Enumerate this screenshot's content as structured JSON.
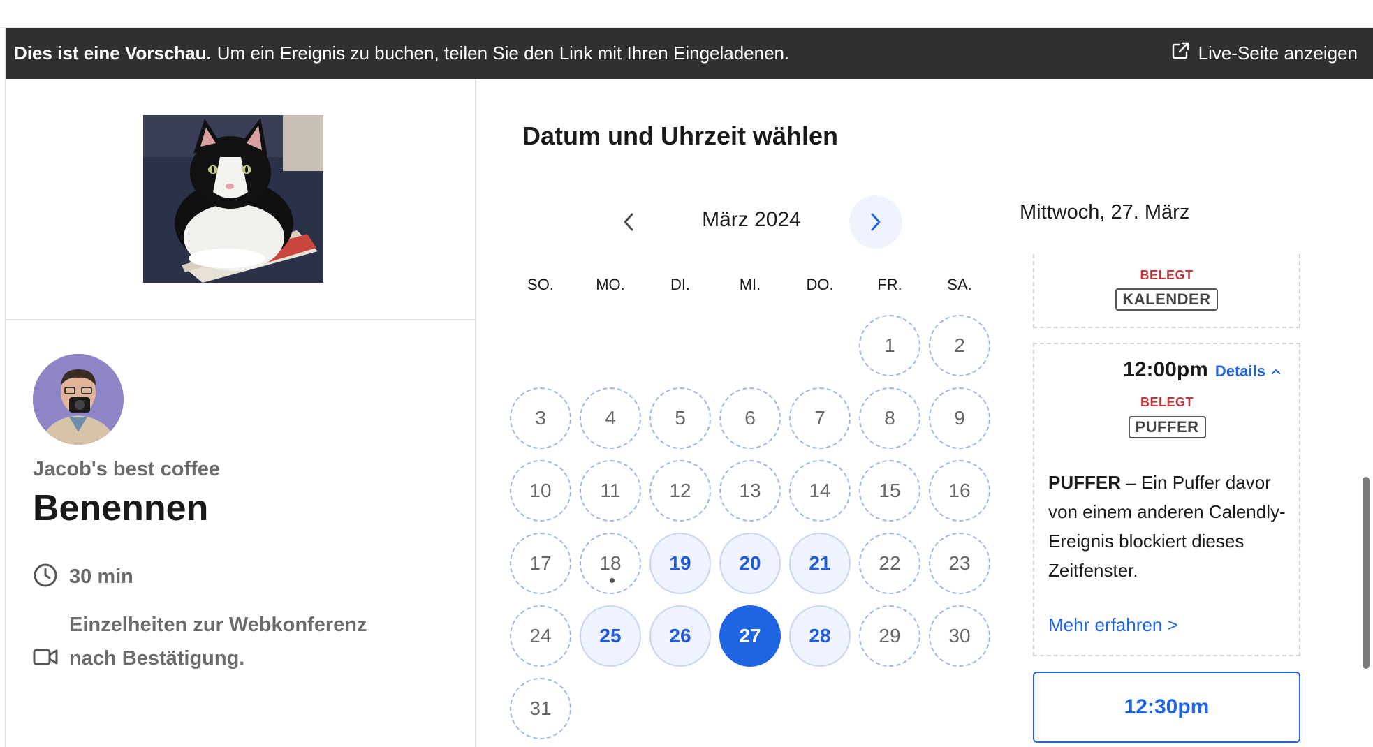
{
  "banner": {
    "bold": "Dies ist eine Vorschau.",
    "text": "Um ein Ereignis zu buchen, teilen Sie den Link mit Ihren Eingeladenen.",
    "live_label": "Live-Seite anzeigen",
    "live_icon": "external-link-icon"
  },
  "profile": {
    "host": "Jacob's best coffee",
    "event_name": "Benennen",
    "duration": "30 min",
    "duration_icon": "clock-icon",
    "conference": "Einzelheiten zur Webkonferenz nach Bestätigung.",
    "conference_icon": "video-camera-icon"
  },
  "scheduler": {
    "title": "Datum und Uhrzeit wählen",
    "month_label": "März 2024",
    "weekdays": [
      "SO.",
      "MO.",
      "DI.",
      "MI.",
      "DO.",
      "FR.",
      "SA."
    ],
    "days": [
      {
        "d": "1",
        "s": "none"
      },
      {
        "d": "2",
        "s": "none"
      },
      {
        "d": "3",
        "s": "none"
      },
      {
        "d": "4",
        "s": "none"
      },
      {
        "d": "5",
        "s": "none"
      },
      {
        "d": "6",
        "s": "none"
      },
      {
        "d": "7",
        "s": "none"
      },
      {
        "d": "8",
        "s": "none"
      },
      {
        "d": "9",
        "s": "none"
      },
      {
        "d": "10",
        "s": "none"
      },
      {
        "d": "11",
        "s": "none"
      },
      {
        "d": "12",
        "s": "none"
      },
      {
        "d": "13",
        "s": "none"
      },
      {
        "d": "14",
        "s": "none"
      },
      {
        "d": "15",
        "s": "none"
      },
      {
        "d": "16",
        "s": "none"
      },
      {
        "d": "17",
        "s": "none"
      },
      {
        "d": "18",
        "s": "today"
      },
      {
        "d": "19",
        "s": "avail"
      },
      {
        "d": "20",
        "s": "avail"
      },
      {
        "d": "21",
        "s": "avail"
      },
      {
        "d": "22",
        "s": "none"
      },
      {
        "d": "23",
        "s": "none"
      },
      {
        "d": "24",
        "s": "none"
      },
      {
        "d": "25",
        "s": "avail"
      },
      {
        "d": "26",
        "s": "avail"
      },
      {
        "d": "27",
        "s": "selected"
      },
      {
        "d": "28",
        "s": "avail"
      },
      {
        "d": "29",
        "s": "none"
      },
      {
        "d": "30",
        "s": "none"
      },
      {
        "d": "31",
        "s": "none"
      }
    ],
    "first_weekday_index": 5
  },
  "slots": {
    "day_title": "Mittwoch, 27. März",
    "slot_a": {
      "status": "BELEGT",
      "tag": "KALENDER"
    },
    "slot_b": {
      "time": "12:00pm",
      "details_label": "Details",
      "status": "BELEGT",
      "tag": "PUFFER",
      "desc_bold": "PUFFER",
      "desc_text": "– Ein Puffer davor von einem anderen Calendly-Ereignis blockiert dieses Zeitfenster.",
      "more_label": "Mehr erfahren >"
    },
    "slot_c": {
      "time": "12:30pm"
    }
  },
  "colors": {
    "accent": "#1f64e0",
    "busy": "#c9363a",
    "banner_bg": "#303030"
  }
}
